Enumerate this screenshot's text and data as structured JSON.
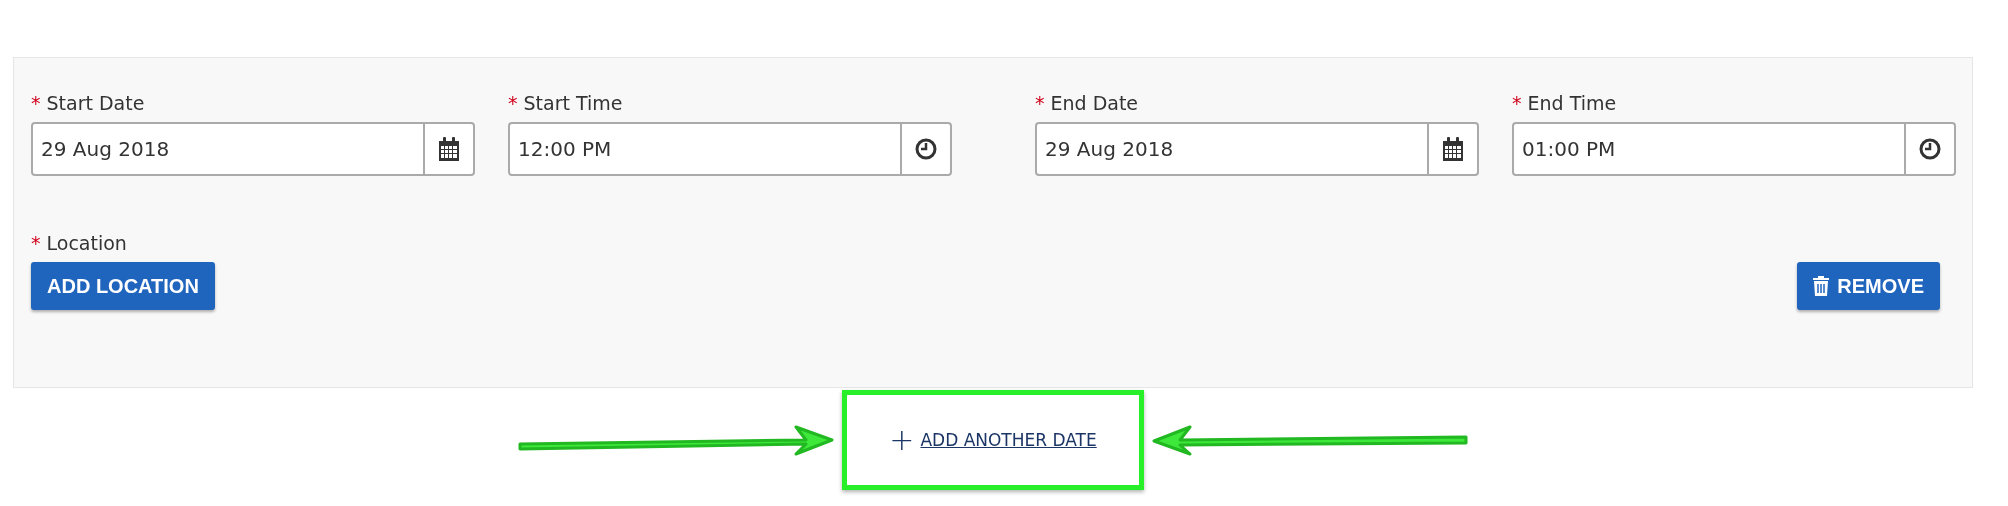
{
  "date_panel": {
    "fields": [
      {
        "marker": "*",
        "label": "Start Date",
        "value": "29 Aug 2018",
        "kind": "date"
      },
      {
        "marker": "*",
        "label": "Start Time",
        "value": "12:00 PM",
        "kind": "time"
      },
      {
        "marker": "*",
        "label": "End Date",
        "value": "29 Aug 2018",
        "kind": "date"
      },
      {
        "marker": "*",
        "label": "End Time",
        "value": "01:00 PM",
        "kind": "time"
      }
    ],
    "location": {
      "marker": "*",
      "label": "Location",
      "button": "ADD LOCATION"
    },
    "remove_button": "REMOVE"
  },
  "add_another_date": {
    "icon": "+",
    "label": "ADD ANOTHER DATE"
  }
}
